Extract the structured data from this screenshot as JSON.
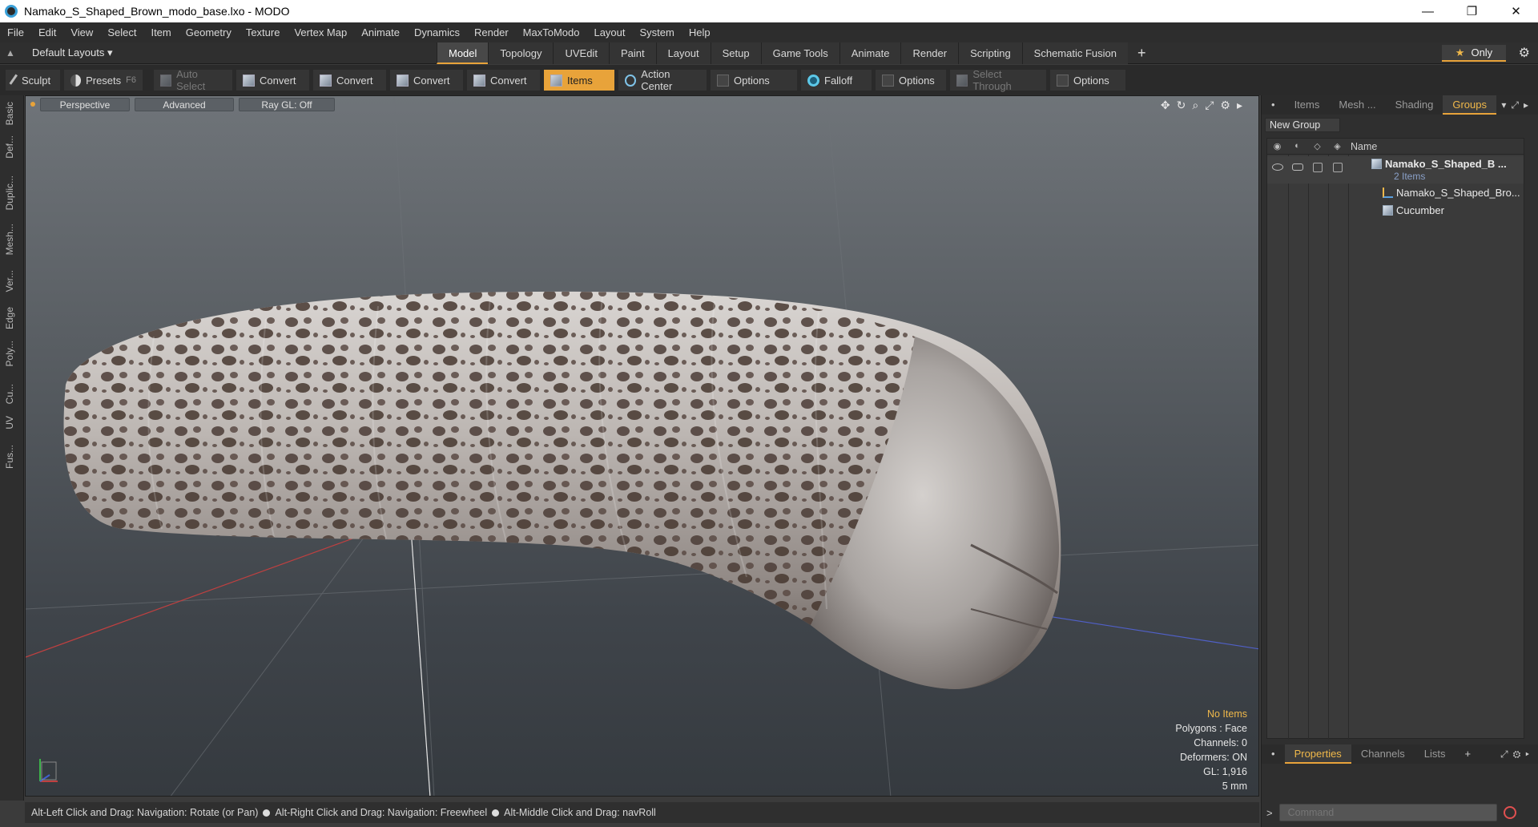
{
  "window": {
    "title": "Namako_S_Shaped_Brown_modo_base.lxo - MODO",
    "minimize": "—",
    "restore": "❐",
    "close": "✕"
  },
  "menu": [
    "File",
    "Edit",
    "View",
    "Select",
    "Item",
    "Geometry",
    "Texture",
    "Vertex Map",
    "Animate",
    "Dynamics",
    "Render",
    "MaxToModo",
    "Layout",
    "System",
    "Help"
  ],
  "layout_selector": "Default Layouts ▾",
  "tabs": [
    "Model",
    "Topology",
    "UVEdit",
    "Paint",
    "Layout",
    "Setup",
    "Game Tools",
    "Animate",
    "Render",
    "Scripting",
    "Schematic Fusion"
  ],
  "active_tab": "Model",
  "only_label": "Only",
  "toolbar": {
    "sculpt": "Sculpt",
    "presets": "Presets",
    "presets_hint": "F6",
    "auto_select": "Auto Select",
    "convert1": "Convert",
    "convert2": "Convert",
    "convert3": "Convert",
    "convert4": "Convert",
    "items": "Items",
    "action_center": "Action Center",
    "options1": "Options",
    "falloff": "Falloff",
    "options2": "Options",
    "select_through": "Select Through",
    "options3": "Options"
  },
  "left_strip": [
    "Basic",
    "Def...",
    "Duplic...",
    "Mesh...",
    "Ver...",
    "Edge",
    "Poly...",
    "Cu...",
    "UV",
    "Fus..."
  ],
  "viewport": {
    "view": "Perspective",
    "shading": "Advanced",
    "raygl": "Ray GL: Off",
    "info": {
      "selection": "No Items",
      "polygons": "Polygons : Face",
      "channels": "Channels: 0",
      "deformers": "Deformers: ON",
      "gl": "GL: 1,916",
      "scale": "5 mm"
    },
    "colors": {
      "x_axis": "#c04040",
      "z_axis": "#5060c8",
      "body": "#b9b5b2",
      "spot": "#5a4a44"
    }
  },
  "status": {
    "hint1": "Alt-Left Click and Drag: Navigation: Rotate (or Pan)",
    "hint2": "Alt-Right Click and Drag: Navigation: Freewheel",
    "hint3": "Alt-Middle Click and Drag: navRoll"
  },
  "right_panel": {
    "tabs": [
      "Items",
      "Mesh ...",
      "Shading",
      "Groups"
    ],
    "active_tab": "Groups",
    "new_group": "New Group",
    "col_name": "Name",
    "group": {
      "name": "Namako_S_Shaped_B ...",
      "count": "2 Items"
    },
    "children": [
      "Namako_S_Shaped_Bro...",
      "Cucumber"
    ],
    "bottom_tabs": [
      "Properties",
      "Channels",
      "Lists"
    ],
    "bottom_active": "Properties",
    "command_placeholder": "Command"
  }
}
